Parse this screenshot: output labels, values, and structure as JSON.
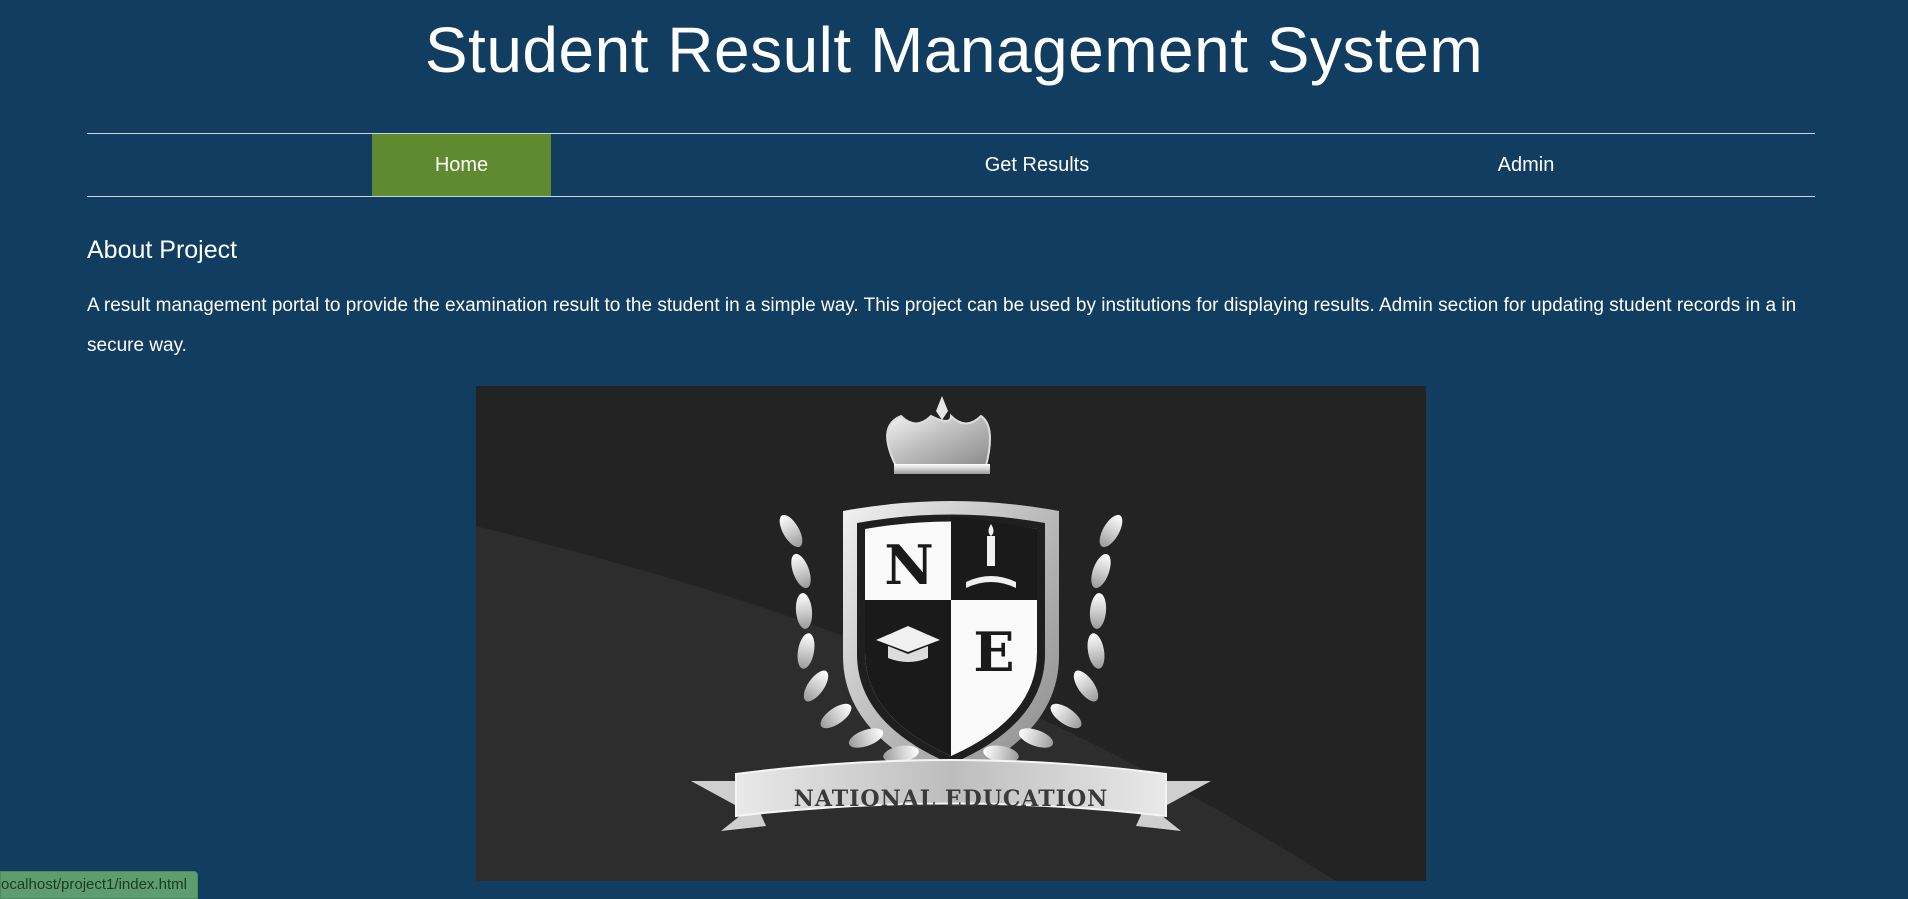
{
  "header": {
    "title": "Student Result Management System"
  },
  "nav": {
    "items": [
      {
        "label": "Home",
        "active": true
      },
      {
        "label": "Get Results",
        "active": false
      },
      {
        "label": "Admin",
        "active": false
      }
    ],
    "active_color": "#5f8a30"
  },
  "about": {
    "heading": "About Project",
    "text": "A result management portal to provide the examination result to the student in a simple way. This project can be used by institutions for displaying results. Admin section for updating student records in a in secure way."
  },
  "logo": {
    "letters": [
      "N",
      "E"
    ],
    "banner": "NATIONAL EDUCATION",
    "icons": [
      "crown-icon",
      "shield-icon",
      "candle-book-icon",
      "graduation-cap-icon",
      "laurel-icon",
      "banner-ribbon-icon"
    ]
  },
  "status_bar": {
    "url": "ocalhost/project1/index.html"
  },
  "colors": {
    "background": "#113d60",
    "nav_active": "#5f8a30",
    "logo_background": "#232323"
  }
}
